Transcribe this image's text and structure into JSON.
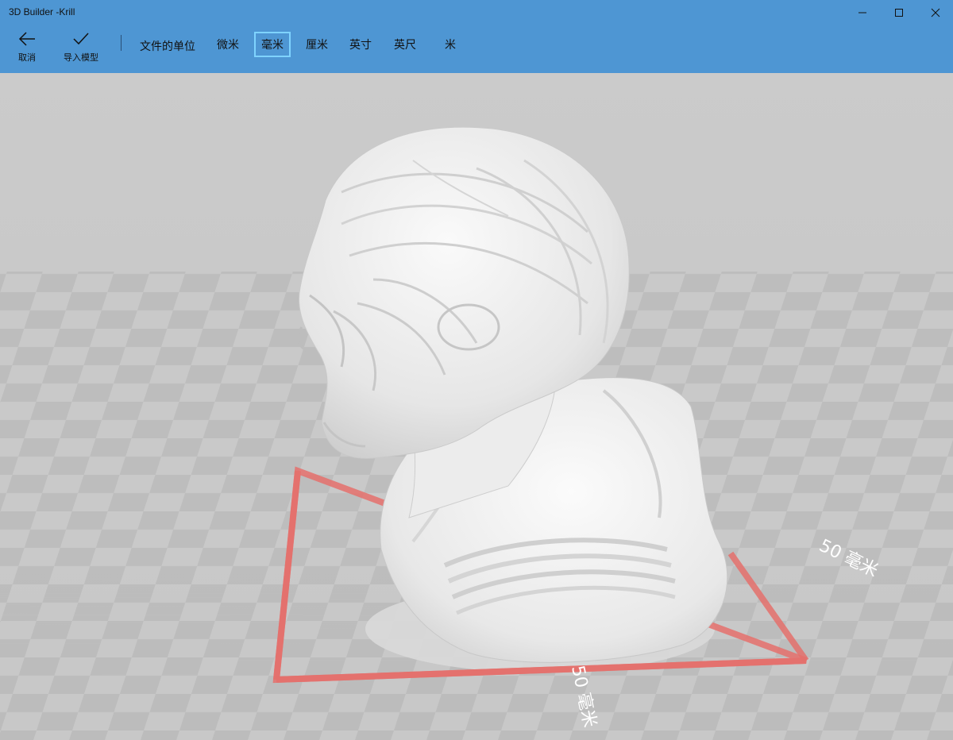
{
  "window": {
    "title": "3D Builder -Krill"
  },
  "toolbar": {
    "cancel_label": "取消",
    "import_label": "导入模型",
    "units_label": "文件的单位",
    "units": [
      "微米",
      "毫米",
      "厘米",
      "英寸",
      "英尺",
      "米"
    ],
    "selected_unit": "毫米"
  },
  "viewport": {
    "dimension_x_label": "50 毫米",
    "dimension_y_label": "50 毫米",
    "floor_colors": {
      "light": "#c9c9c9",
      "dark": "#b9b9b9"
    },
    "bounds_color": "#e5706c"
  },
  "colors": {
    "ribbon": "#4e96d3",
    "selected_unit_border": "#7fd3ff"
  }
}
